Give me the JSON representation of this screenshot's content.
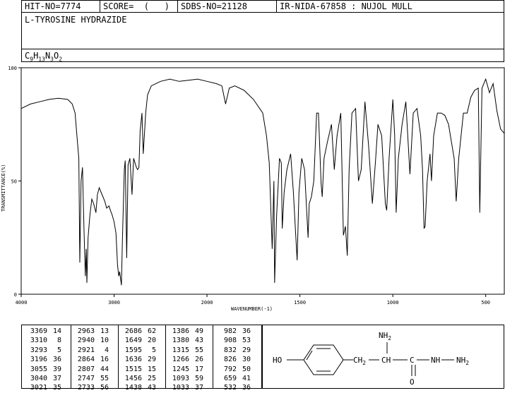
{
  "header": {
    "hit_no": "HIT-NO=7774",
    "score": "SCORE=  (   )",
    "sdbs_no": "SDBS-NO=21128",
    "ir_nida": "IR-NIDA-67858 : NUJOL MULL",
    "compound": "L-TYROSINE HYDRAZIDE",
    "formula": {
      "C": "9",
      "H": "13",
      "N": "3",
      "O": "2"
    }
  },
  "chart_data": {
    "type": "line",
    "xlabel": "WAVENUMBER(-1)",
    "ylabel": "TRANSMITTANCE(%)",
    "xlim": [
      4000,
      400
    ],
    "ylim": [
      0,
      100
    ],
    "x_ticks": [
      "4000",
      "3000",
      "2000",
      "1500",
      "1000",
      "500"
    ],
    "y_ticks": [
      "0",
      "50",
      "100"
    ],
    "series": [
      {
        "x": [
          4000,
          3900,
          3800,
          3700,
          3600,
          3500,
          3450,
          3420,
          3400,
          3380,
          3369,
          3355,
          3340,
          3325,
          3310,
          3300,
          3293,
          3280,
          3260,
          3240,
          3220,
          3196,
          3180,
          3160,
          3140,
          3120,
          3100,
          3080,
          3055,
          3040,
          3021,
          3000,
          2980,
          2963,
          2950,
          2940,
          2921,
          2910,
          2890,
          2880,
          2864,
          2850,
          2830,
          2807,
          2790,
          2760,
          2747,
          2733,
          2720,
          2700,
          2686,
          2660,
          2640,
          2600,
          2500,
          2400,
          2300,
          2200,
          2100,
          2000,
          1950,
          1920,
          1900,
          1880,
          1850,
          1800,
          1750,
          1700,
          1680,
          1665,
          1649,
          1640,
          1636,
          1625,
          1610,
          1600,
          1595,
          1585,
          1570,
          1550,
          1535,
          1525,
          1515,
          1505,
          1490,
          1475,
          1456,
          1450,
          1438,
          1425,
          1410,
          1400,
          1386,
          1380,
          1370,
          1350,
          1330,
          1315,
          1300,
          1280,
          1266,
          1255,
          1245,
          1235,
          1220,
          1200,
          1185,
          1170,
          1150,
          1130,
          1110,
          1093,
          1080,
          1060,
          1050,
          1040,
          1033,
          1020,
          1000,
          990,
          982,
          970,
          950,
          930,
          908,
          890,
          870,
          850,
          840,
          832,
          826,
          815,
          800,
          792,
          780,
          760,
          740,
          720,
          700,
          690,
          670,
          659,
          645,
          620,
          600,
          580,
          560,
          540,
          532,
          520,
          500,
          480,
          460,
          440,
          420,
          400
        ],
        "y": [
          82,
          84,
          85,
          86,
          86.5,
          86,
          84,
          80,
          70,
          60,
          14,
          50,
          56,
          30,
          8,
          20,
          5,
          25,
          35,
          42,
          40,
          36,
          44,
          47,
          45,
          43,
          41,
          38,
          39,
          37,
          35,
          32,
          27,
          13,
          8,
          10,
          4,
          25,
          55,
          59,
          16,
          57,
          60,
          44,
          60,
          56,
          55,
          56,
          72,
          80,
          62,
          80,
          88,
          92,
          94,
          95,
          94,
          94.5,
          95,
          94,
          93,
          92,
          84,
          91,
          92,
          90,
          86,
          80,
          70,
          58,
          20,
          50,
          5,
          35,
          60,
          58,
          29,
          45,
          55,
          62,
          45,
          30,
          15,
          45,
          60,
          55,
          25,
          40,
          43,
          50,
          80,
          80,
          49,
          43,
          60,
          68,
          75,
          55,
          70,
          80,
          26,
          30,
          17,
          55,
          80,
          82,
          50,
          55,
          85,
          65,
          40,
          59,
          75,
          70,
          55,
          40,
          37,
          60,
          86,
          70,
          36,
          60,
          75,
          85,
          53,
          80,
          82,
          70,
          55,
          29,
          30,
          50,
          62,
          50,
          70,
          80,
          80,
          79,
          75,
          70,
          60,
          41,
          60,
          80,
          80,
          87,
          90,
          91,
          36,
          91,
          95,
          89,
          93,
          81,
          73,
          71
        ]
      }
    ]
  },
  "peak_table": [
    [
      [
        "3369",
        "14"
      ],
      [
        "3310",
        "8"
      ],
      [
        "3293",
        "5"
      ],
      [
        "3196",
        "36"
      ],
      [
        "3055",
        "39"
      ],
      [
        "3040",
        "37"
      ],
      [
        "3021",
        "35"
      ]
    ],
    [
      [
        "2963",
        "13"
      ],
      [
        "2940",
        "10"
      ],
      [
        "2921",
        "4"
      ],
      [
        "2864",
        "16"
      ],
      [
        "2807",
        "44"
      ],
      [
        "2747",
        "55"
      ],
      [
        "2733",
        "56"
      ]
    ],
    [
      [
        "2686",
        "62"
      ],
      [
        "1649",
        "20"
      ],
      [
        "1595",
        "5"
      ],
      [
        "1636",
        "29"
      ],
      [
        "1515",
        "15"
      ],
      [
        "1456",
        "25"
      ],
      [
        "1438",
        "43"
      ]
    ],
    [
      [
        "1386",
        "49"
      ],
      [
        "1380",
        "43"
      ],
      [
        "1315",
        "55"
      ],
      [
        "1266",
        "26"
      ],
      [
        "1245",
        "17"
      ],
      [
        "1093",
        "59"
      ],
      [
        "1033",
        "37"
      ]
    ],
    [
      [
        "982",
        "36"
      ],
      [
        "908",
        "53"
      ],
      [
        "832",
        "29"
      ],
      [
        "826",
        "30"
      ],
      [
        "792",
        "50"
      ],
      [
        "659",
        "41"
      ],
      [
        "532",
        "36"
      ]
    ]
  ],
  "structure": {
    "ho": "HO",
    "ch2": "CH",
    "ch2_sub": "2",
    "ch": "CH",
    "c": "C",
    "nh2_top": "NH",
    "nh2_top_sub": "2",
    "o": "O",
    "nh": "NH",
    "nh2_end": "NH",
    "nh2_end_sub": "2"
  }
}
